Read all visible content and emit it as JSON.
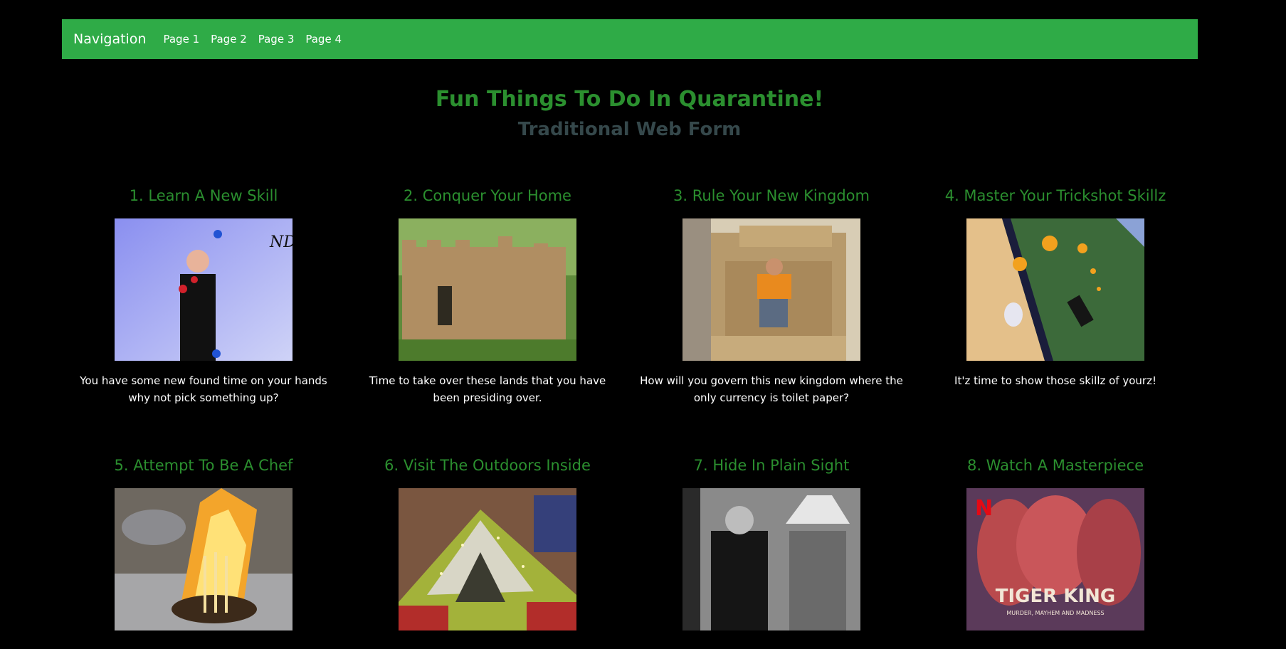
{
  "nav": {
    "brand": "Navigation",
    "links": [
      "Page 1",
      "Page 2",
      "Page 3",
      "Page 4"
    ]
  },
  "hero": {
    "title": "Fun Things To Do In Quarantine!",
    "subtitle": "Traditional Web Form"
  },
  "cards": [
    {
      "title": "1. Learn A New Skill",
      "text": "You have some new found time on your hands why not pick something up?",
      "image": "juggler-photo"
    },
    {
      "title": "2. Conquer Your Home",
      "text": "Time to take over these lands that you have been presiding over.",
      "image": "cardboard-castle-photo"
    },
    {
      "title": "3. Rule Your New Kingdom",
      "text": "How will you govern this new kingdom where the only currency is toilet paper?",
      "image": "toilet-paper-throne-photo"
    },
    {
      "title": "4. Master Your Trickshot Skillz",
      "text": "It'z time to show those skillz of yourz!",
      "image": "trickshot-photo"
    },
    {
      "title": "5. Attempt To Be A Chef",
      "text": "",
      "image": "flaming-pasta-photo"
    },
    {
      "title": "6. Visit The Outdoors Inside",
      "text": "",
      "image": "indoor-tent-photo"
    },
    {
      "title": "7. Hide In Plain Sight",
      "text": "",
      "image": "lamp-disguise-photo"
    },
    {
      "title": "8. Watch A Masterpiece",
      "text": "",
      "image": "tiger-king-poster",
      "poster_text": "TIGER KING",
      "poster_sub": "MURDER, MAYHEM AND MADNESS",
      "poster_logo": "N"
    }
  ]
}
